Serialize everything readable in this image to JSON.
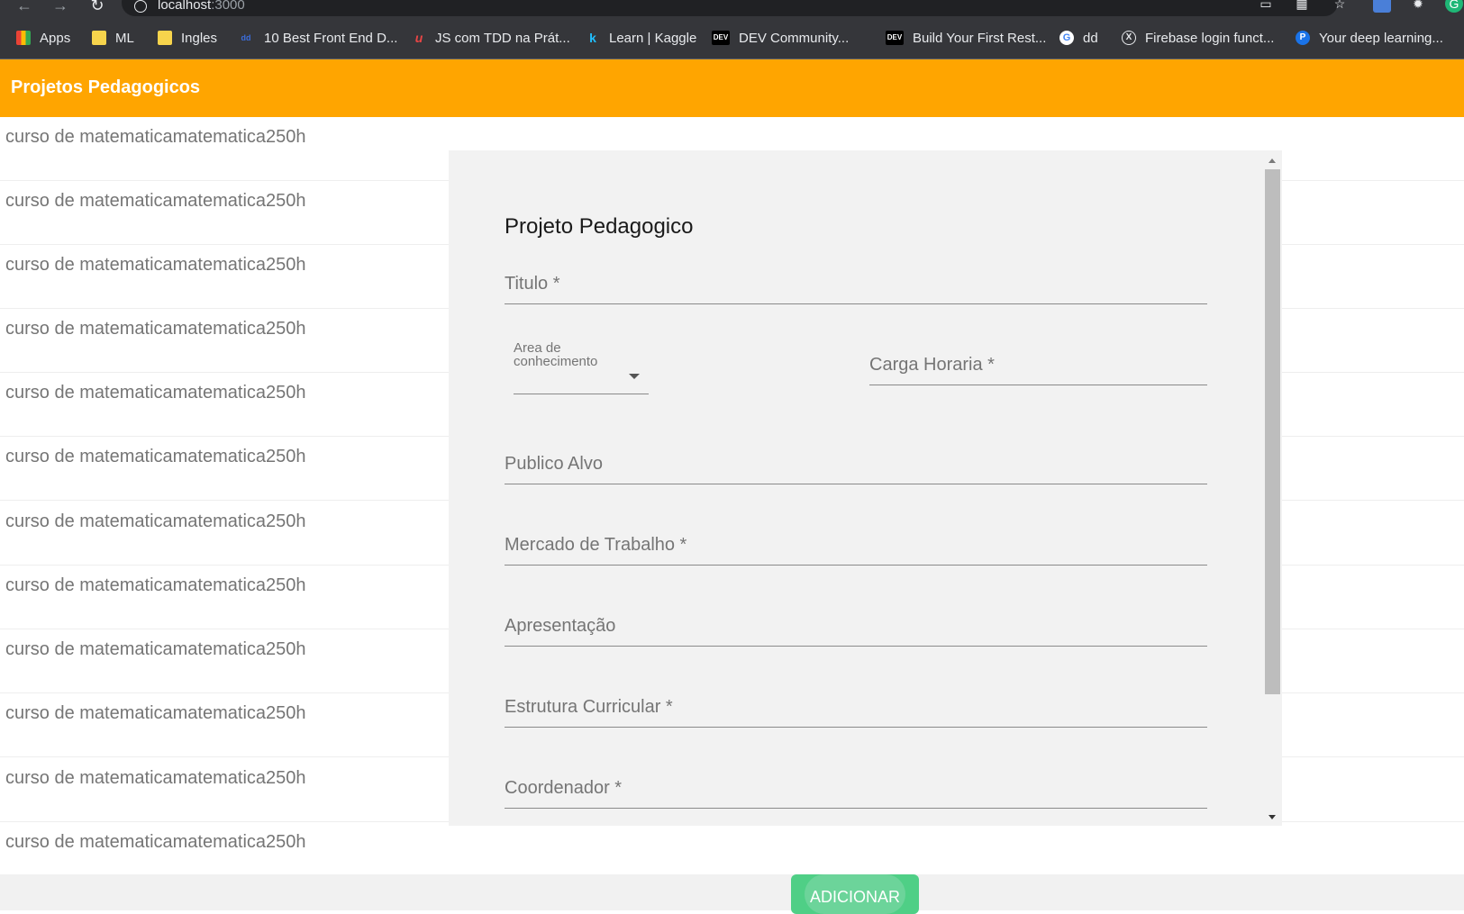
{
  "browser": {
    "url_host": "localhost",
    "url_port": ":3000",
    "bookmarks": [
      {
        "label": "Apps",
        "icon": "apps-grid-icon"
      },
      {
        "label": "ML",
        "icon": "folder-icon"
      },
      {
        "label": "Ingles",
        "icon": "folder-icon"
      },
      {
        "label": "10 Best Front End D...",
        "icon": "dd-icon"
      },
      {
        "label": "JS com TDD na Prát...",
        "icon": "u-icon"
      },
      {
        "label": "Learn | Kaggle",
        "icon": "kaggle-icon"
      },
      {
        "label": "DEV Community...",
        "icon": "dev-icon"
      },
      {
        "label": "Build Your First Rest...",
        "icon": "dev-icon"
      },
      {
        "label": "dd",
        "icon": "google-icon"
      },
      {
        "label": "Firebase login funct...",
        "icon": "x-circle-icon"
      },
      {
        "label": "Your deep learning...",
        "icon": "p-icon"
      }
    ]
  },
  "app": {
    "title": "Projetos Pedagogicos",
    "add_button_label": "ADICIONAR",
    "colors": {
      "app_bar": "#ffa500",
      "add_button": "#4fcf86"
    }
  },
  "project_list": [
    "curso de matematicamatematica250h",
    "curso de matematicamatematica250h",
    "curso de matematicamatematica250h",
    "curso de matematicamatematica250h",
    "curso de matematicamatematica250h",
    "curso de matematicamatematica250h",
    "curso de matematicamatematica250h",
    "curso de matematicamatematica250h",
    "curso de matematicamatematica250h",
    "curso de matematicamatematica250h",
    "curso de matematicamatematica250h",
    "curso de matematicamatematica250h"
  ],
  "dialog": {
    "title": "Projeto Pedagogico",
    "fields": {
      "titulo": "Titulo *",
      "area_conhecimento": "Area de conhecimento",
      "carga_horaria": "Carga Horaria *",
      "publico_alvo": "Publico Alvo",
      "mercado_trabalho": "Mercado de Trabalho *",
      "apresentacao": "Apresentação",
      "estrutura_curricular": "Estrutura Curricular *",
      "coordenador": "Coordenador *"
    }
  }
}
